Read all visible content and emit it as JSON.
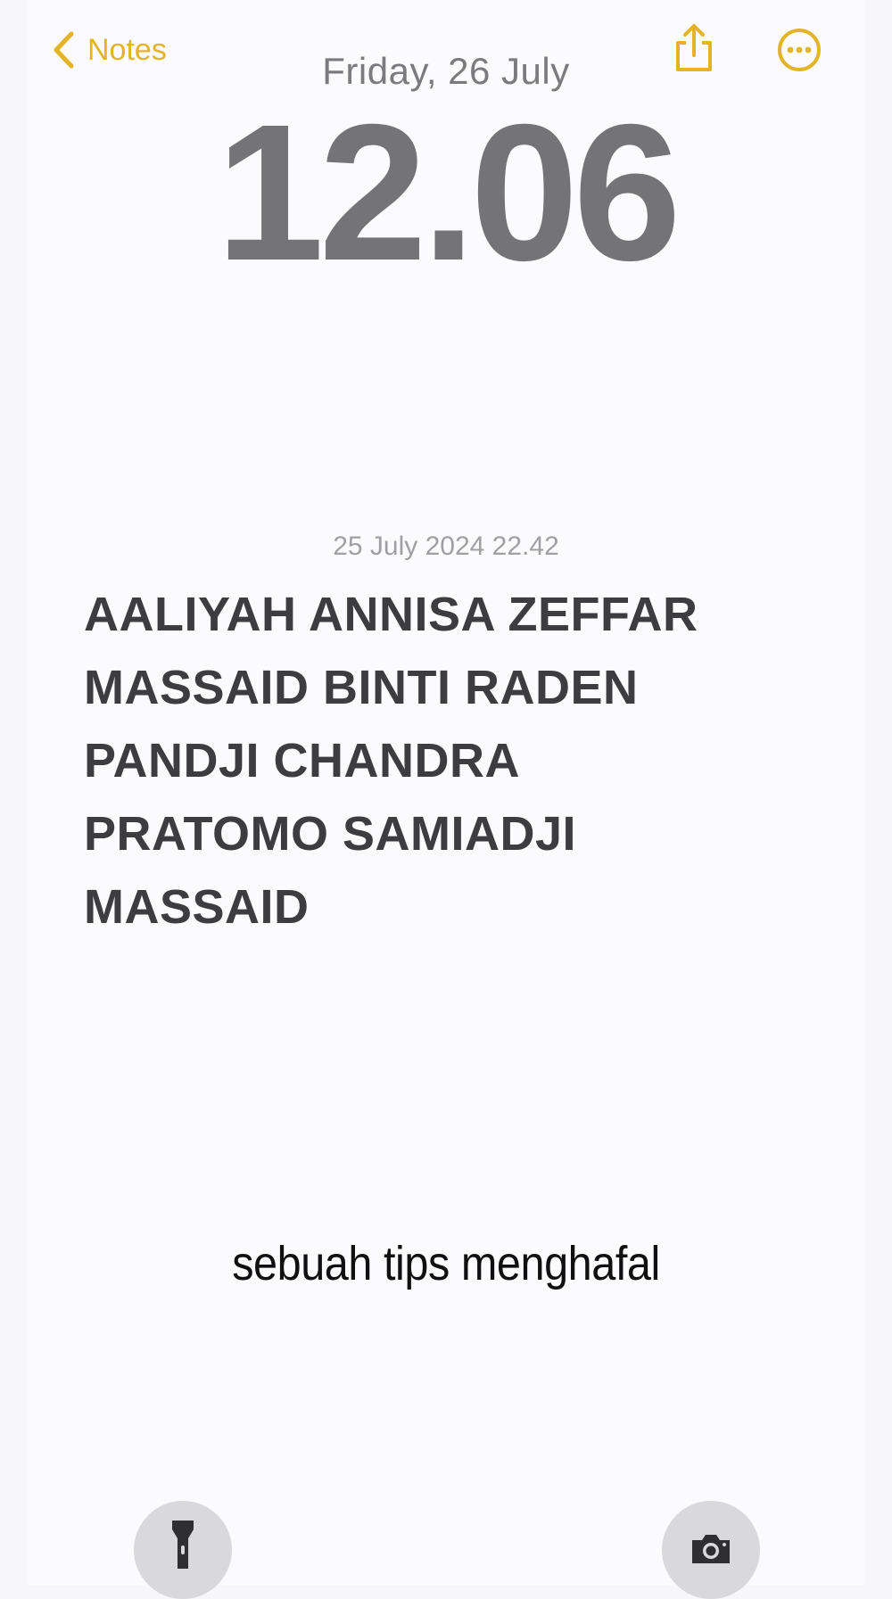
{
  "app": {
    "back_label": "Notes"
  },
  "lock_screen": {
    "date": "Friday, 26 July",
    "time": "12.06"
  },
  "note": {
    "timestamp": "25 July 2024 22.42",
    "lines": [
      "AALIYAH ANNISA ZEFFAR",
      "MASSAID BINTI RADEN",
      "PANDJI CHANDRA",
      "PRATOMO SAMIADJI",
      "MASSAID"
    ]
  },
  "caption": "sebuah tips menghafal",
  "icons": {
    "back": "chevron-left-icon",
    "share": "share-icon",
    "more": "more-icon",
    "flashlight": "flashlight-icon",
    "camera": "camera-icon"
  },
  "colors": {
    "accent": "#e3b328",
    "clock": "#747377",
    "note_text": "#3d3c41"
  }
}
